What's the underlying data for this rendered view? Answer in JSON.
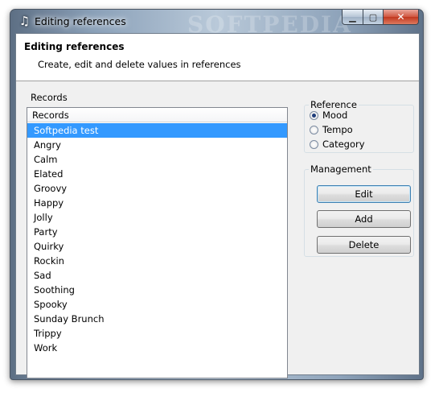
{
  "window": {
    "title": "Editing references",
    "watermark": "SOFTPEDIA"
  },
  "header": {
    "title": "Editing references",
    "subtitle": "Create, edit and delete values in references"
  },
  "records": {
    "group_label": "Records",
    "column_header": "Records",
    "items": [
      "Softpedia test",
      "Angry",
      "Calm",
      "Elated",
      "Groovy",
      "Happy",
      "Jolly",
      "Party",
      "Quirky",
      "Rockin",
      "Sad",
      "Soothing",
      "Spooky",
      "Sunday Brunch",
      "Trippy",
      "Work"
    ],
    "selected_index": 0
  },
  "reference": {
    "group_label": "Reference",
    "options": [
      "Mood",
      "Tempo",
      "Category"
    ],
    "selected": "Mood"
  },
  "management": {
    "group_label": "Management",
    "edit_label": "Edit",
    "add_label": "Add",
    "delete_label": "Delete"
  },
  "colors": {
    "selection": "#3399ff",
    "client_bg": "#f0f0f0",
    "close_button": "#c1381f"
  }
}
